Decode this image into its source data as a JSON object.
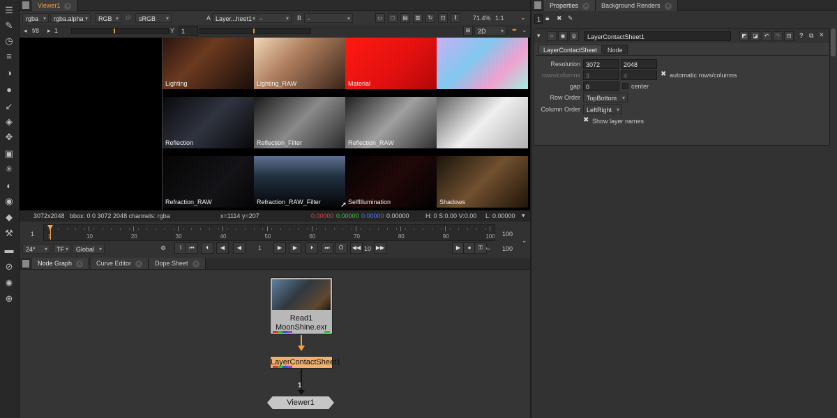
{
  "toolbar": {
    "tools": [
      "viewer-tool-icon",
      "paint-icon",
      "time-icon",
      "channel-icon",
      "color-icon",
      "draw-icon",
      "keyer-icon",
      "merge-icon",
      "transform-icon",
      "3d-icon",
      "particles-icon",
      "deep-icon",
      "views-icon",
      "metadata-icon",
      "toolsets-icon",
      "other-icon",
      "furnace-icon",
      "cara-icon",
      "globe-icon"
    ]
  },
  "viewer_tab": {
    "label": "Viewer1"
  },
  "viewer_controls": {
    "channels": "rgba",
    "alpha": "rgba.alpha",
    "display": "RGB",
    "ip": "IP",
    "lut": "sRGB",
    "input_a_prefix": "A",
    "input_a": "Layer...heet1",
    "input_a_op": "-",
    "input_b_prefix": "B",
    "input_b": "-",
    "zoom": "71.4%",
    "ratio": "1:1"
  },
  "viewer_row2": {
    "fstop": "f/8",
    "frame": "1",
    "y_label": "Y",
    "y_value": "1",
    "mode": "2D"
  },
  "contact_sheet": {
    "tiles": [
      {
        "label": "Lighting",
        "bg": "linear-gradient(135deg,#2a1410,#6b3a20 40%,#1a0e0a)"
      },
      {
        "label": "Lighting_RAW",
        "bg": "linear-gradient(135deg,#f0d8b8,#b08060 40%,#3a2418)"
      },
      {
        "label": "Material",
        "bg": "linear-gradient(135deg,#ff1a10,#e01010 60%,#b00808)"
      },
      {
        "label": "",
        "bg": "linear-gradient(135deg,#c8b0f0,#80c8f0 40%,#f0a0d0 70%,#a0f0e0)"
      },
      {
        "label": "Reflection",
        "bg": "linear-gradient(135deg,#0a0a0c,#303440 50%,#08080a)"
      },
      {
        "label": "Reflection_Filter",
        "bg": "linear-gradient(135deg,#1a1a1a,#8a8a8a 50%,#2a2a2a)"
      },
      {
        "label": "Reflection_RAW",
        "bg": "linear-gradient(135deg,#202020,#a0a0a0 50%,#303030)"
      },
      {
        "label": "",
        "bg": "linear-gradient(135deg,#606060,#f0f0f0 50%,#b0b0b0)"
      },
      {
        "label": "Refraction_RAW",
        "bg": "linear-gradient(135deg,#050505,#141418 60%,#050505)"
      },
      {
        "label": "Refraction_RAW_Filter",
        "bg": "linear-gradient(180deg,#607090,#203040 40%,#050505)"
      },
      {
        "label": "SelfIllumination",
        "bg": "linear-gradient(135deg,#050202,#200808 50%,#040202)"
      },
      {
        "label": "Shadows",
        "bg": "linear-gradient(135deg,#1a140c,#705030 50%,#201408)"
      }
    ]
  },
  "infobar": {
    "format": "3072x2048",
    "bbox": "bbox: 0 0 3072 2048 channels: rgba",
    "coords": "x=1114 y=207",
    "r": "0.00000",
    "g": "0.00000",
    "b": "0.00000",
    "a": "0.00000",
    "hsv": "H:   0 S:0.00 V:0.00",
    "l": "L: 0.00000"
  },
  "timeline": {
    "start": "1",
    "end": "100",
    "ticks": [
      "1",
      "10",
      "20",
      "30",
      "40",
      "50",
      "60",
      "70",
      "80",
      "90",
      "100"
    ]
  },
  "playback": {
    "fps": "24*",
    "tf": "TF",
    "global": "Global",
    "frame": "1",
    "step": "10",
    "end": "100"
  },
  "bottom_tabs": [
    "Node Graph",
    "Curve Editor",
    "Dope Sheet"
  ],
  "nodes": {
    "read_name": "Read1",
    "read_file": "MoonShine.exr",
    "sheet": "LayerContactSheet1",
    "pipe_label": "1",
    "viewer": "Viewer1"
  },
  "right_tabs": [
    "Properties",
    "Background Renders"
  ],
  "properties_toolbar": {
    "max_panels": "1"
  },
  "properties": {
    "node_name": "LayerContactSheet1",
    "tabs": [
      "LayerContactSheet",
      "Node"
    ],
    "resolution_label": "Resolution",
    "res_w": "3072",
    "res_h": "2048",
    "rowscols_label": "rows/columns",
    "rows": "3",
    "cols": "4",
    "auto_label": "automatic rows/columns",
    "gap_label": "gap",
    "gap": "0",
    "center_label": "center",
    "row_order_label": "Row Order",
    "row_order": "TopBottom",
    "col_order_label": "Column Order",
    "col_order": "LeftRight",
    "show_names_label": "Show layer names"
  },
  "colors": {
    "accent": "#f5a043",
    "node_orange": "#f0b070",
    "red": "#e04040",
    "green": "#40c040",
    "blue": "#4060ff"
  }
}
